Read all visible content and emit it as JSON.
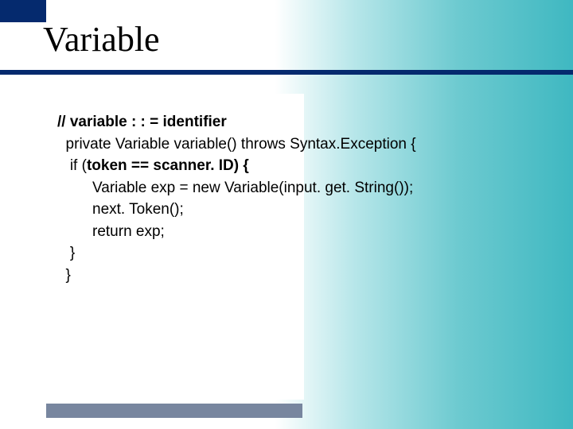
{
  "slide": {
    "title": "Variable",
    "code": {
      "l1": "// variable : : = identifier",
      "l2_pre": "  private Variable variable() throws Syntax.Exception {",
      "l3_pre": "   if (",
      "l3_bold": "token == scanner. ID) {",
      "l4": "Variable exp = new Variable(input. get. String());",
      "l5": "next. Token();",
      "l6": "return exp;",
      "l7": "   }",
      "l8": "  }"
    }
  }
}
